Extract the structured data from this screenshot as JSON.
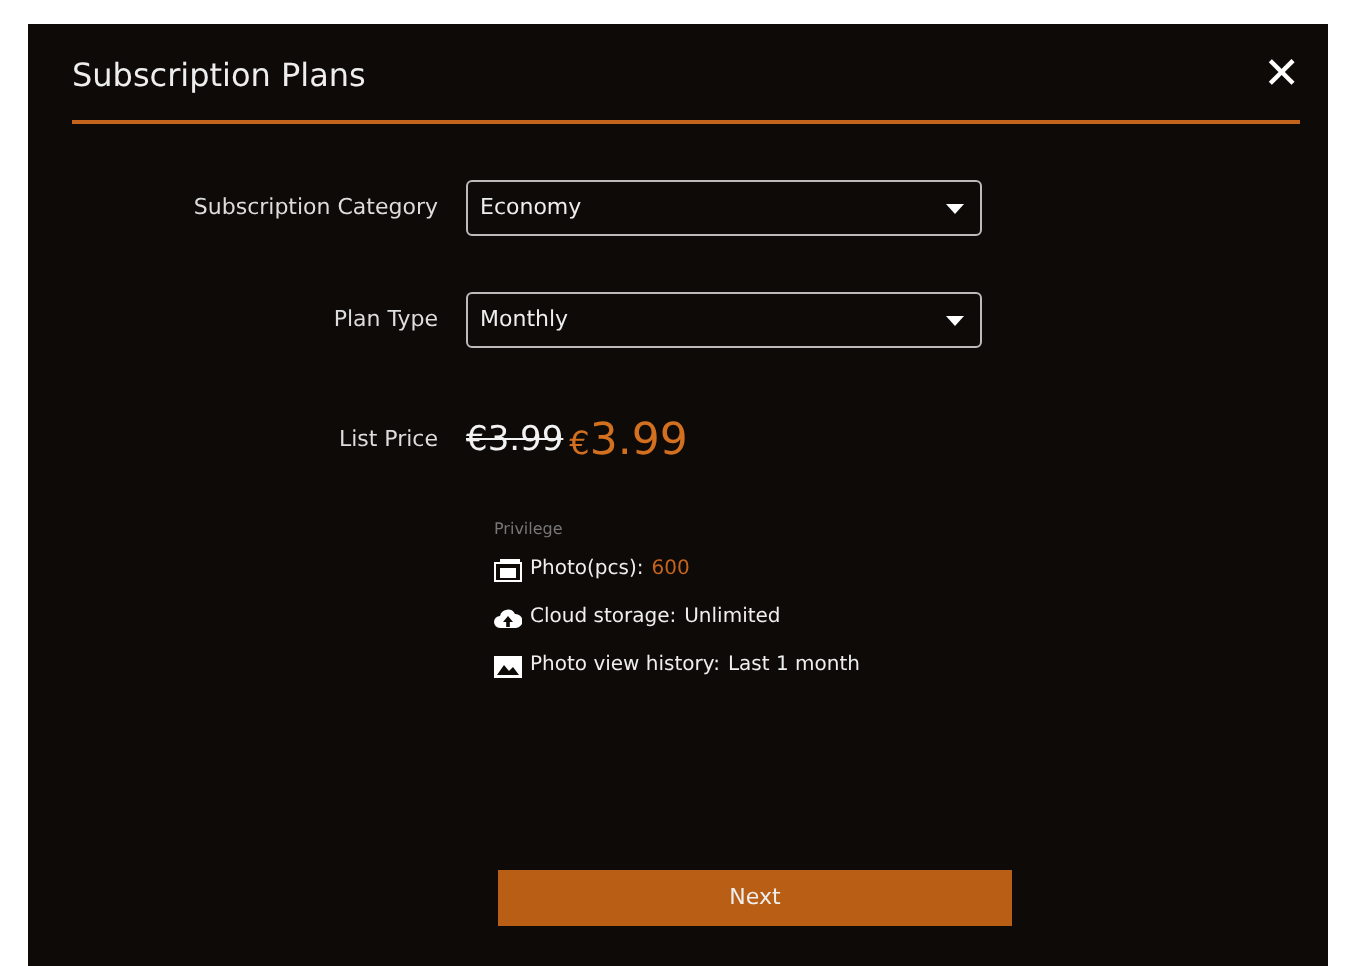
{
  "modal": {
    "title": "Subscription Plans",
    "close": "✕"
  },
  "fields": [
    {
      "label": "Subscription Category",
      "value": "Economy"
    },
    {
      "label": "Plan Type",
      "value": "Monthly"
    }
  ],
  "price": {
    "label": "List Price",
    "old": "€3.99",
    "new_currency": "€",
    "new_amount": "3.99"
  },
  "privilege": {
    "heading": "Privilege",
    "items": [
      {
        "kind": "photos",
        "label": "Photo(pcs):",
        "value": "600",
        "highlight": true
      },
      {
        "kind": "cloud",
        "label": "Cloud storage:",
        "value": "Unlimited",
        "highlight": false
      },
      {
        "kind": "history",
        "label": "Photo view history:",
        "value": "Last 1 month",
        "highlight": false
      }
    ]
  },
  "next_button": "Next"
}
